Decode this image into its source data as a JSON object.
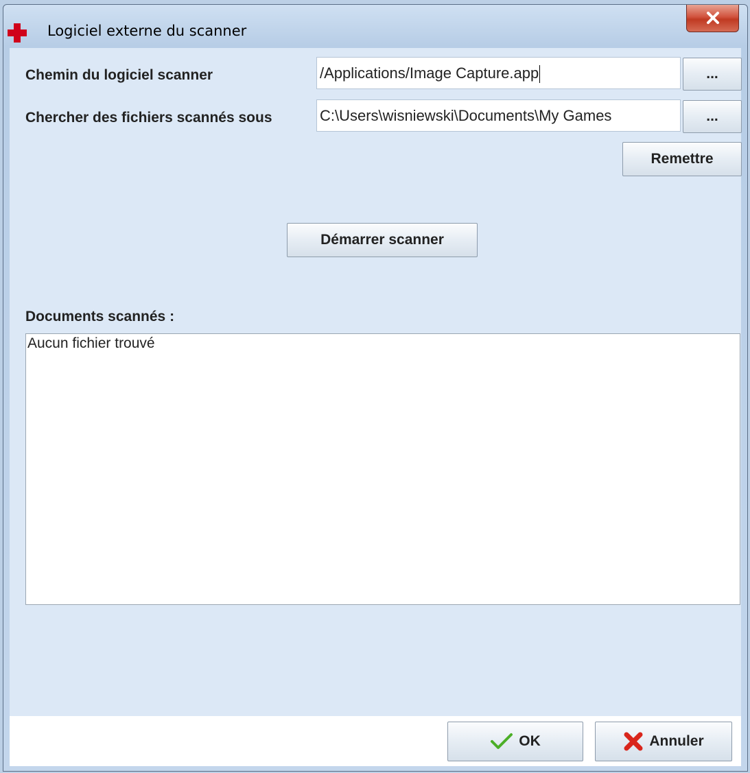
{
  "window": {
    "title": "Logiciel externe du scanner",
    "close_label": "X"
  },
  "form": {
    "scanner_path_label": "Chemin du logiciel scanner",
    "scanner_path_value": "/Applications/Image Capture.app",
    "search_dir_label": "Chercher des fichiers scannés sous",
    "search_dir_value": "C:\\Users\\wisniewski\\Documents\\My Games",
    "browse_label": "...",
    "reset_label": "Remettre",
    "start_label": "Démarrer scanner"
  },
  "documents": {
    "label": "Documents scannés :",
    "content": "Aucun fichier trouvé"
  },
  "footer": {
    "ok_label": "OK",
    "cancel_label": "Annuler"
  },
  "colors": {
    "title_icon": "#d0021b",
    "ok_icon": "#4caf28",
    "cancel_icon": "#d9261c"
  }
}
